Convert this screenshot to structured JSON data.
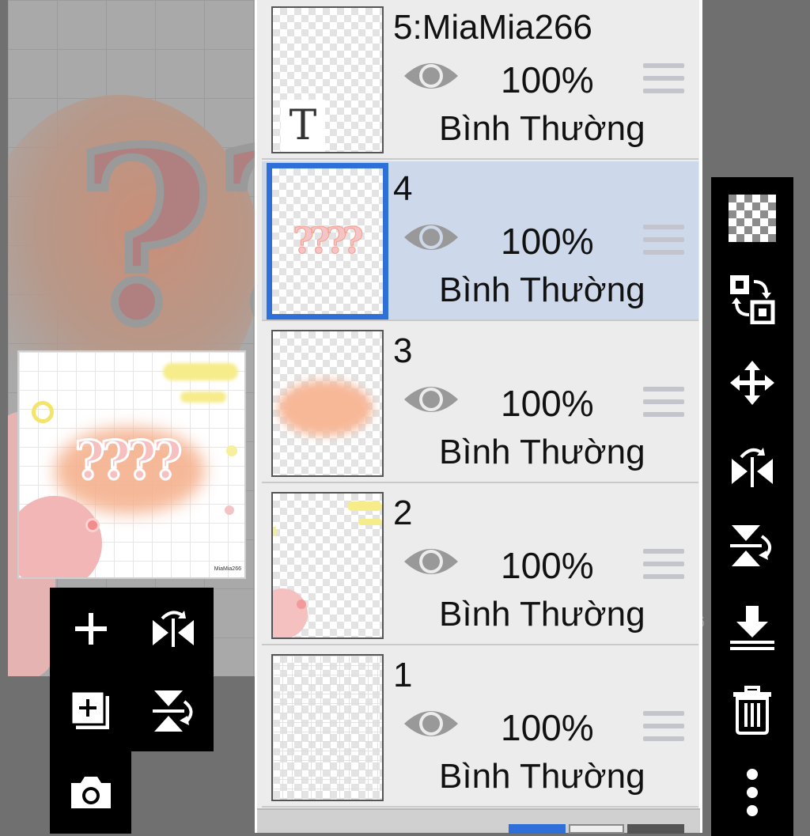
{
  "layers": [
    {
      "name": "5:MiaMia266",
      "opacity": "100%",
      "blend": "Bình Thường",
      "selected": false,
      "thumb_text": "T"
    },
    {
      "name": "4",
      "opacity": "100%",
      "blend": "Bình Thường",
      "selected": true,
      "thumb_text": "????"
    },
    {
      "name": "3",
      "opacity": "100%",
      "blend": "Bình Thường",
      "selected": false
    },
    {
      "name": "2",
      "opacity": "100%",
      "blend": "Bình Thường",
      "selected": false
    },
    {
      "name": "1",
      "opacity": "100%",
      "blend": "Bình Thường",
      "selected": false
    }
  ],
  "preview": {
    "marks": "????",
    "signature": "MiaMia266"
  },
  "canvas": {
    "marks": "??",
    "stray_digit": "6"
  },
  "left_toolbar": [
    "add-layer-icon",
    "flip-horizontal-icon",
    "add-copy-layer-icon",
    "flip-vertical-icon",
    "camera-icon"
  ],
  "right_toolbar": [
    "transparent-background-icon",
    "swap-layers-icon",
    "move-icon",
    "flip-horizontal-icon",
    "flip-vertical-icon",
    "merge-down-icon",
    "trash-icon",
    "more-icon"
  ],
  "colors": {
    "selected_row": "#cdd8ea",
    "selected_border": "#2f6fd8",
    "toolbar": "#000000",
    "panel": "#ececec"
  }
}
